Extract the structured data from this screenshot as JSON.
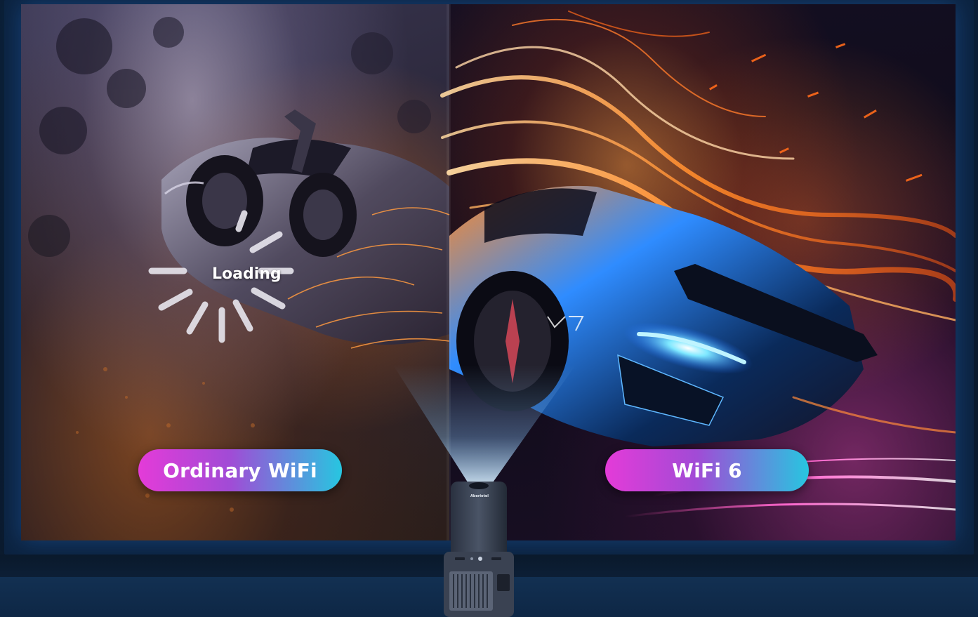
{
  "comparison": {
    "left_label": "Ordinary WiFi",
    "right_label": "WiFi 6",
    "loading_text": "Loading"
  },
  "projector": {
    "brand_text": "Aberiotel"
  },
  "colors": {
    "pill_gradient_start": "#e43bd8",
    "pill_gradient_end": "#27c6e0",
    "background": "#0a1a2e"
  }
}
